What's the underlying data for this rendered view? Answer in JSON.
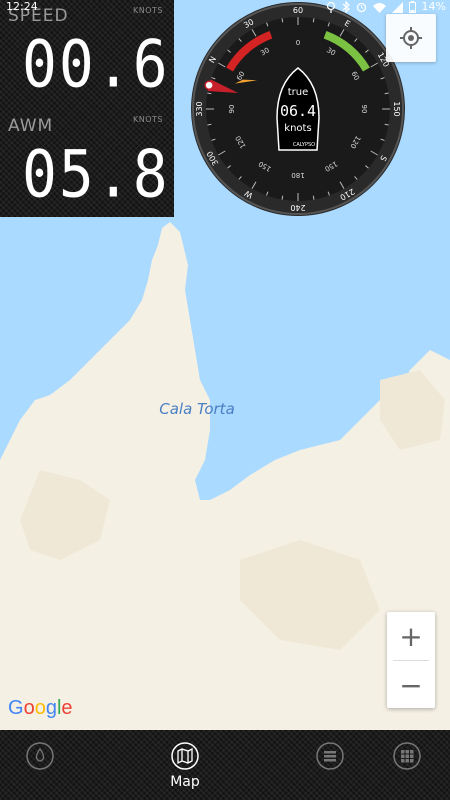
{
  "status": {
    "time": "12:24",
    "battery": "14%"
  },
  "panel": {
    "speed_label": "SPEED",
    "speed_unit": "KNOTS",
    "speed_value": "00.6",
    "awm_label": "AWM",
    "awm_unit": "KNOTS",
    "awm_value": "05.8"
  },
  "compass": {
    "center_label": "true",
    "center_value": "06.4",
    "center_unit": "knots",
    "brand": "CALYPSO",
    "outer_labels": [
      {
        "t": "N",
        "a": 0
      },
      {
        "t": "30",
        "a": 30
      },
      {
        "t": "60",
        "a": 60
      },
      {
        "t": "E",
        "a": 90
      },
      {
        "t": "120",
        "a": 120
      },
      {
        "t": "150",
        "a": 150
      },
      {
        "t": "S",
        "a": 180
      },
      {
        "t": "210",
        "a": 210
      },
      {
        "t": "240",
        "a": 240
      },
      {
        "t": "W",
        "a": 270
      },
      {
        "t": "300",
        "a": 300
      },
      {
        "t": "330",
        "a": 330
      }
    ],
    "inner_labels": [
      {
        "t": "0",
        "a": 0
      },
      {
        "t": "30",
        "a": 30
      },
      {
        "t": "60",
        "a": 60
      },
      {
        "t": "90",
        "a": 90
      },
      {
        "t": "120",
        "a": 120
      },
      {
        "t": "150",
        "a": 150
      },
      {
        "t": "180",
        "a": 180
      },
      {
        "t": "150",
        "a": 210
      },
      {
        "t": "120",
        "a": 240
      },
      {
        "t": "90",
        "a": 270
      },
      {
        "t": "60",
        "a": 300
      },
      {
        "t": "30",
        "a": 330
      }
    ],
    "heading_deg": -60,
    "colors": {
      "port": "#d42323",
      "starboard": "#7cc242",
      "pointer": "#f0a030"
    }
  },
  "map": {
    "place_label": "Cala Torta",
    "water": "#aadaff",
    "land": "#f5f0e4"
  },
  "zoom": {
    "in": "+",
    "out": "−"
  },
  "attribution": {
    "g1": "G",
    "o1": "o",
    "o2": "o",
    "g2": "g",
    "l": "l",
    "e": "e"
  },
  "nav": {
    "map_label": "Map"
  }
}
